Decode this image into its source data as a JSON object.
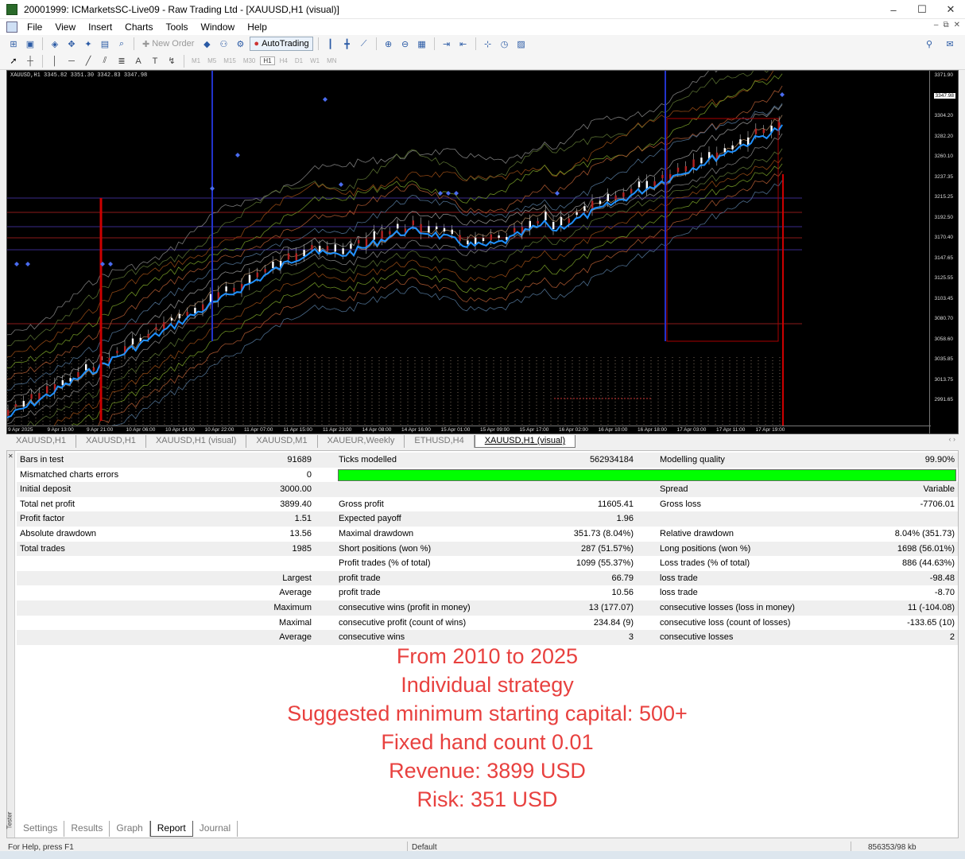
{
  "window": {
    "title": "20001999: ICMarketsSC-Live09 - Raw Trading Ltd - [XAUUSD,H1 (visual)]",
    "minimize": "–",
    "maximize": "☐",
    "close": "✕"
  },
  "menu": [
    "File",
    "View",
    "Insert",
    "Charts",
    "Tools",
    "Window",
    "Help"
  ],
  "toolbar": {
    "new_order": "New Order",
    "autotrading": "AutoTrading",
    "timeframes": [
      "M1",
      "M5",
      "M15",
      "M30",
      "H1",
      "H4",
      "D1",
      "W1",
      "MN"
    ],
    "selected_timeframe": "H1"
  },
  "chart": {
    "symbol_info": "XAUUSD,H1  3345.82 3351.30 3342.83 3347.98",
    "current_price": "3347.98",
    "price_labels": [
      "3371.90",
      "3326.35",
      "3304.20",
      "3282.20",
      "3260.10",
      "3237.35",
      "3215.25",
      "3192.50",
      "3170.40",
      "3147.65",
      "3125.55",
      "3103.45",
      "3080.70",
      "3058.60",
      "3035.85",
      "3013.75",
      "2991.65"
    ],
    "time_labels": [
      "9 Apr 2025",
      "9 Apr 13:00",
      "9 Apr 21:00",
      "10 Apr 06:00",
      "10 Apr 14:00",
      "10 Apr 22:00",
      "11 Apr 07:00",
      "11 Apr 15:00",
      "11 Apr 23:00",
      "14 Apr 08:00",
      "14 Apr 16:00",
      "15 Apr 01:00",
      "15 Apr 09:00",
      "15 Apr 17:00",
      "16 Apr 02:00",
      "16 Apr 10:00",
      "16 Apr 18:00",
      "17 Apr 03:00",
      "17 Apr 11:00",
      "17 Apr 19:00"
    ],
    "colors": {
      "background": "#000000",
      "ma_main": "#1e90ff",
      "bull": "#ffffff",
      "bear": "#b22222"
    }
  },
  "chart_tabs": [
    "XAUUSD,H1",
    "XAUUSD,H1",
    "XAUUSD,H1 (visual)",
    "XAUUSD,M1",
    "XAUEUR,Weekly",
    "ETHUSD,H4",
    "XAUUSD,H1 (visual)"
  ],
  "tab_arrows": "‹ ›",
  "report": {
    "rows": [
      {
        "c1": "Bars in test",
        "c2": "91689",
        "c3": "Ticks modelled",
        "c4": "562934184",
        "c5": "Modelling quality",
        "c6": "99.90%"
      },
      {
        "c1": "Mismatched charts errors",
        "c2": "0",
        "c3": "",
        "c4": "",
        "c5": "",
        "c6": ""
      },
      {
        "c1": "Initial deposit",
        "c2": "3000.00",
        "c3": "",
        "c4": "",
        "c5": "Spread",
        "c6": "Variable"
      },
      {
        "c1": "Total net profit",
        "c2": "3899.40",
        "c3": "Gross profit",
        "c4": "11605.41",
        "c5": "Gross loss",
        "c6": "-7706.01"
      },
      {
        "c1": "Profit factor",
        "c2": "1.51",
        "c3": "Expected payoff",
        "c4": "1.96",
        "c5": "",
        "c6": ""
      },
      {
        "c1": "Absolute drawdown",
        "c2": "13.56",
        "c3": "Maximal drawdown",
        "c4": "351.73 (8.04%)",
        "c5": "Relative drawdown",
        "c6": "8.04% (351.73)"
      },
      {
        "c1": "Total trades",
        "c2": "1985",
        "c3": "Short positions (won %)",
        "c4": "287 (51.57%)",
        "c5": "Long positions (won %)",
        "c6": "1698 (56.01%)"
      },
      {
        "c1": "",
        "c2": "",
        "c3": "Profit trades (% of total)",
        "c4": "1099 (55.37%)",
        "c5": "Loss trades (% of total)",
        "c6": "886 (44.63%)"
      },
      {
        "c1": "",
        "c2": "Largest",
        "c3": "profit trade",
        "c4": "66.79",
        "c5": "loss trade",
        "c6": "-98.48"
      },
      {
        "c1": "",
        "c2": "Average",
        "c3": "profit trade",
        "c4": "10.56",
        "c5": "loss trade",
        "c6": "-8.70"
      },
      {
        "c1": "",
        "c2": "Maximum",
        "c3": "consecutive wins (profit in money)",
        "c4": "13 (177.07)",
        "c5": "consecutive losses (loss in money)",
        "c6": "11 (-104.08)"
      },
      {
        "c1": "",
        "c2": "Maximal",
        "c3": "consecutive profit (count of wins)",
        "c4": "234.84 (9)",
        "c5": "consecutive loss (count of losses)",
        "c6": "-133.65 (10)"
      },
      {
        "c1": "",
        "c2": "Average",
        "c3": "consecutive wins",
        "c4": "3",
        "c5": "consecutive losses",
        "c6": "2"
      }
    ]
  },
  "overlay_lines": [
    "From 2010 to 2025",
    "Individual strategy",
    "Suggested minimum starting capital: 500+",
    "Fixed hand count 0.01",
    "Revenue: 3899 USD",
    "Risk: 351 USD"
  ],
  "tester_label": "Tester",
  "bottom_tabs": [
    "Settings",
    "Results",
    "Graph",
    "Report",
    "Journal"
  ],
  "status": {
    "help": "For Help, press F1",
    "profile": "Default",
    "traffic": "856353/98 kb"
  }
}
